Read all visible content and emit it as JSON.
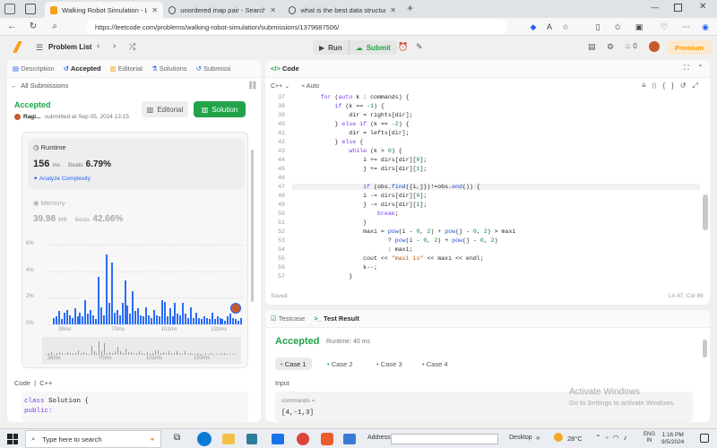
{
  "browser": {
    "tabs": [
      {
        "title": "Walking Robot Simulation - Leetc",
        "active": true
      },
      {
        "title": "unordered map pair - Search",
        "active": false
      },
      {
        "title": "what is the best data structure to",
        "active": false
      }
    ],
    "url": "https://leetcode.com/problems/walking-robot-simulation/submissions/1379687506/"
  },
  "toolbar": {
    "problem_list": "Problem List",
    "run": "Run",
    "submit": "Submit",
    "streak": "0",
    "premium": "Premium"
  },
  "left_tabs": [
    "Description",
    "Accepted",
    "Editorial",
    "Solutions",
    "Submissi"
  ],
  "submission": {
    "back": "All Submissions",
    "status": "Accepted",
    "user": "Ragi...",
    "submitted": "submitted at Sep 05, 2024 13:15",
    "editorial_btn": "Editorial",
    "solution_btn": "Solution",
    "runtime_label": "Runtime",
    "runtime_value": "156",
    "runtime_unit": "ms",
    "beats_label": "Beats",
    "runtime_beats": "6.79%",
    "analyze": "Analyze Complexity",
    "memory_label": "Memory",
    "memory_value": "39.98",
    "memory_unit": "MB",
    "memory_beats": "42.66%"
  },
  "chart_data": {
    "type": "bar",
    "y_ticks": [
      "6%",
      "4%",
      "2%",
      "0%"
    ],
    "x_ticks": [
      "38ms",
      "70ms",
      "101ms",
      "133ms"
    ],
    "values": [
      0.5,
      0.6,
      1,
      0.4,
      0.9,
      1.1,
      0.7,
      0.5,
      1.2,
      0.6,
      0.9,
      0.6,
      1.8,
      0.8,
      1.1,
      0.7,
      0.4,
      3.6,
      1.3,
      0.7,
      5.3,
      1.6,
      4.7,
      0.9,
      1.1,
      0.7,
      1.6,
      3.3,
      1.4,
      0.8,
      2.5,
      1,
      1.2,
      0.7,
      0.6,
      1.3,
      0.7,
      0.5,
      1.1,
      0.7,
      0.6,
      1.8,
      1.7,
      0.6,
      1.2,
      0.6,
      1.6,
      0.8,
      0.7,
      1.6,
      0.8,
      0.5,
      1.3,
      0.5,
      0.9,
      0.5,
      0.4,
      0.6,
      0.5,
      0.4,
      0.9,
      0.4,
      0.6,
      0.5,
      0.4,
      0.3,
      0.6,
      0.8,
      0.5,
      0.4,
      0.3,
      0.5
    ],
    "ylim": [
      0,
      6.5
    ],
    "highlight_x": "156ms"
  },
  "code_label": "Code",
  "code_lang": "C++",
  "left_code": [
    {
      "kw": "class",
      "rest": " Solution {"
    },
    {
      "kw": "public:",
      "rest": ""
    }
  ],
  "editor": {
    "title": "Code",
    "lang": "C++",
    "auto": "Auto",
    "saved": "Saved",
    "cursor": "Ln 47, Col 49",
    "line_numbers": [
      "37",
      "38",
      "39",
      "40",
      "41",
      "42",
      "43",
      "44",
      "45",
      "46",
      "47",
      "48",
      "49",
      "50",
      "51",
      "52",
      "53",
      "54",
      "55",
      "56",
      "57"
    ],
    "lines": [
      "        for (auto k : commands) {",
      "            if (k == -1) {",
      "                dir = rights[dir];",
      "            } else if (k == -2) {",
      "                dir = lefts[dir];",
      "            } else {",
      "                while (k > 0) {",
      "                    i += dirs[dir][0];",
      "                    j += dirs[dir][1];",
      "",
      "                    if (obs.find({i,j})!=obs.end()) {",
      "                    i -= dirs[dir][0];",
      "                    j -= dirs[dir][1];",
      "                        break;",
      "                    }",
      "                    maxi = pow(i - 0, 2) + pow(j - 0, 2) > maxi",
      "                           ? pow(i - 0, 2) + pow(j - 0, 2)",
      "                           : maxi;",
      "                    cout << \"maxi is\" << maxi << endl;",
      "                    k--;",
      "                }"
    ]
  },
  "console": {
    "testcase_tab": "Testcase",
    "result_tab": "Test Result",
    "status": "Accepted",
    "runtime": "Runtime: 40 ms",
    "cases": [
      "Case 1",
      "Case 2",
      "Case 3",
      "Case 4"
    ],
    "input_label": "Input",
    "param": "commands =",
    "param_value": "[4,-1,3]"
  },
  "watermark": {
    "line1": "Activate Windows",
    "line2": "Go to Settings to activate Windows."
  },
  "taskbar": {
    "search": "Type here to search",
    "address": "Address",
    "desktop": "Desktop",
    "weather": "28°C",
    "lang1": "ENG",
    "lang2": "IN",
    "time": "1:16 PM",
    "date": "9/5/2024"
  }
}
